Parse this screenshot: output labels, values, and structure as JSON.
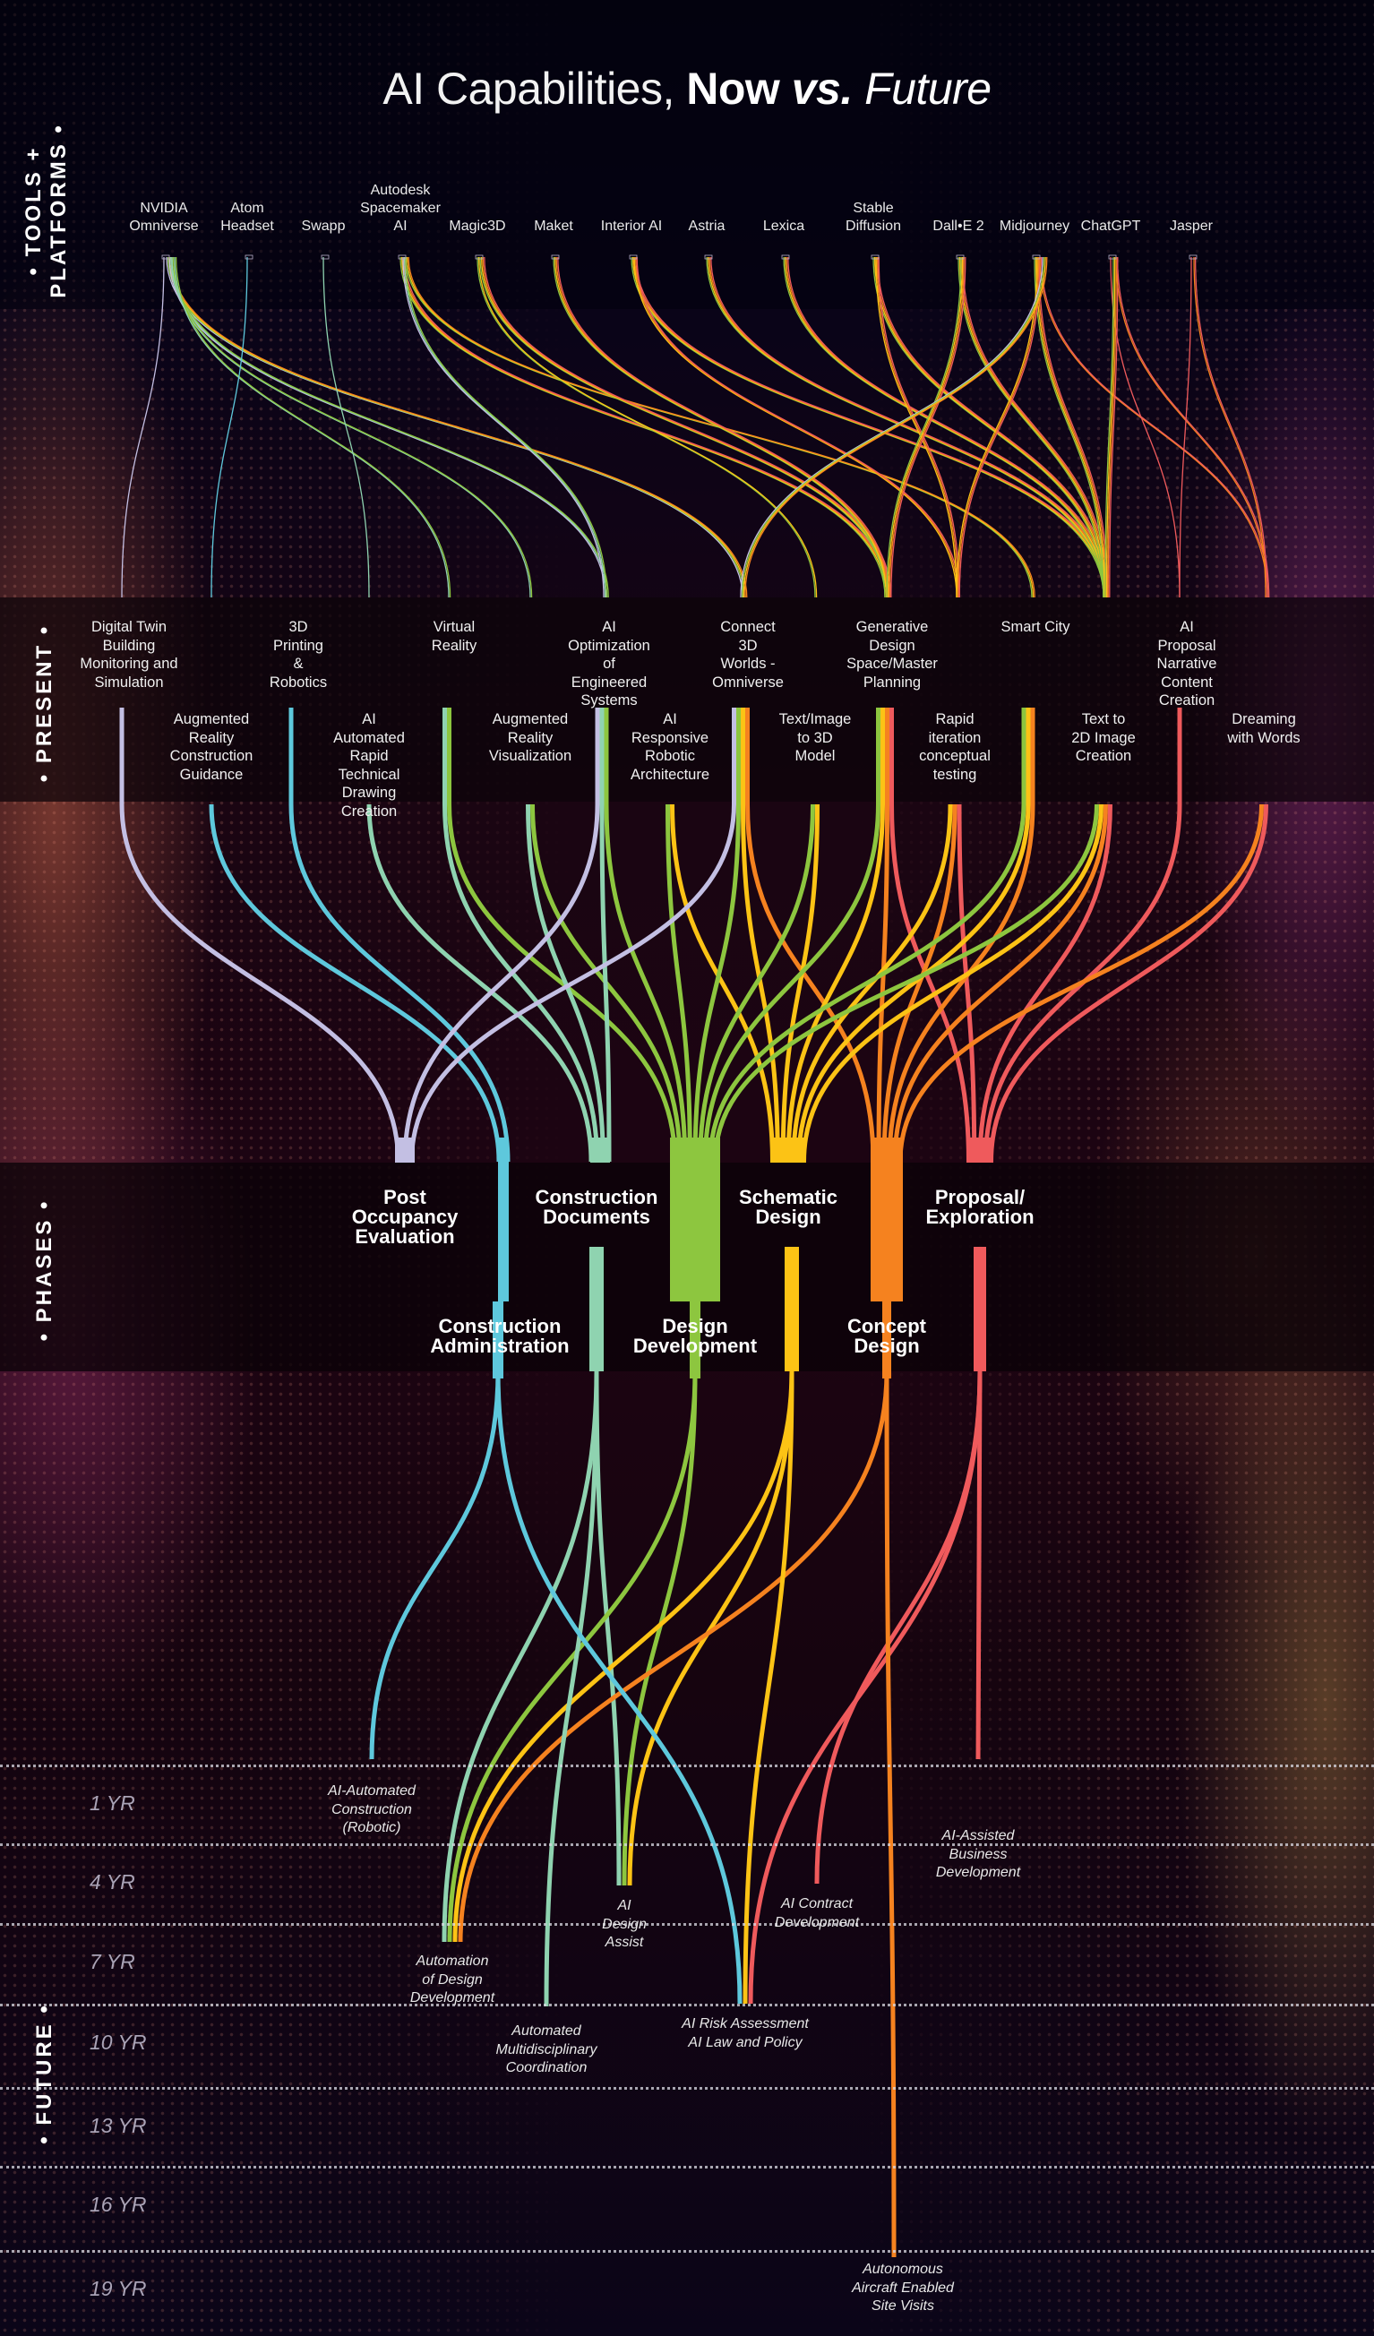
{
  "title": {
    "part1": "AI Capabilities, ",
    "part2": "Now",
    "part3": " vs.",
    "part4": " Future"
  },
  "sections": {
    "tools": "• TOOLS + PLATFORMS •",
    "tools_line1": "• TOOLS +",
    "tools_line2": "PLATFORMS •",
    "present": "• PRESENT •",
    "phases": "• PHASES •",
    "future": "• FUTURE •"
  },
  "colors": {
    "post_occupancy": "#c3bfe3",
    "construction_admin": "#5ec8dc",
    "construction_documents": "#8fd3b0",
    "design_development": "#8dc63f",
    "schematic_design": "#fcc315",
    "concept_design": "#f5821f",
    "proposal_exploration": "#ef5a5c"
  },
  "tools": [
    {
      "label": "NVIDIA\nOmniverse"
    },
    {
      "label": "Atom\nHeadset"
    },
    {
      "label": "Swapp"
    },
    {
      "label": "Autodesk\nSpacemaker\nAI"
    },
    {
      "label": "Magic3D"
    },
    {
      "label": "Maket"
    },
    {
      "label": "Interior AI"
    },
    {
      "label": "Astria"
    },
    {
      "label": "Lexica"
    },
    {
      "label": "Stable\nDiffusion"
    },
    {
      "label": "Dall•E 2"
    },
    {
      "label": "Midjourney"
    },
    {
      "label": "ChatGPT"
    },
    {
      "label": "Jasper"
    }
  ],
  "present": [
    {
      "label": "Digital Twin\nBuilding\nMonitoring and\nSimulation",
      "row": 1
    },
    {
      "label": "Augmented\nReality\nConstruction\nGuidance",
      "row": 2
    },
    {
      "label": "3D\nPrinting\n&\nRobotics",
      "row": 1
    },
    {
      "label": "AI\nAutomated\nRapid\nTechnical\nDrawing\nCreation",
      "row": 2
    },
    {
      "label": "Virtual\nReality",
      "row": 1
    },
    {
      "label": "Augmented\nReality\nVisualization",
      "row": 2
    },
    {
      "label": "AI\nOptimization\nof\nEngineered\nSystems",
      "row": 1
    },
    {
      "label": "AI\nResponsive\nRobotic\nArchitecture",
      "row": 2
    },
    {
      "label": "Connect\n3D\nWorlds -\nOmniverse",
      "row": 1
    },
    {
      "label": "Text/Image\nto 3D\nModel",
      "row": 2
    },
    {
      "label": "Generative\nDesign\nSpace/Master\nPlanning",
      "row": 1
    },
    {
      "label": "Rapid\niteration\nconceptual\ntesting",
      "row": 2
    },
    {
      "label": "Smart City",
      "row": 1
    },
    {
      "label": "Text to\n2D Image\nCreation",
      "row": 2
    },
    {
      "label": "AI\nProposal\nNarrative\nContent\nCreation",
      "row": 1
    },
    {
      "label": "Dreaming\nwith Words",
      "row": 2
    }
  ],
  "phases": [
    {
      "key": "post_occupancy",
      "label": "Post\nOccupancy\nEvaluation",
      "row": 1
    },
    {
      "key": "construction_admin",
      "label": "Construction\nAdministration",
      "row": 2
    },
    {
      "key": "construction_documents",
      "label": "Construction\nDocuments",
      "row": 1
    },
    {
      "key": "design_development",
      "label": "Design\nDevelopment",
      "row": 2
    },
    {
      "key": "schematic_design",
      "label": "Schematic\nDesign",
      "row": 1
    },
    {
      "key": "concept_design",
      "label": "Concept\nDesign",
      "row": 2
    },
    {
      "key": "proposal_exploration",
      "label": "Proposal/\nExploration",
      "row": 1
    }
  ],
  "timeline": [
    "1 YR",
    "4 YR",
    "7 YR",
    "10 YR",
    "13 YR",
    "16 YR",
    "19 YR"
  ],
  "future": [
    {
      "label": "AI-Automated\nConstruction\n(Robotic)",
      "years": 1,
      "phases": [
        "construction_admin"
      ]
    },
    {
      "label": "AI-Assisted\nBusiness\nDevelopment",
      "years": 1,
      "phases": [
        "proposal_exploration"
      ]
    },
    {
      "label": "AI\nDesign\nAssist",
      "years": 4,
      "phases": [
        "construction_documents",
        "design_development",
        "schematic_design"
      ]
    },
    {
      "label": "AI Contract\nDevelopment",
      "years": 4,
      "phases": [
        "proposal_exploration"
      ]
    },
    {
      "label": "Automation\nof Design\nDevelopment",
      "years": 7,
      "phases": [
        "construction_documents",
        "design_development",
        "schematic_design",
        "concept_design"
      ]
    },
    {
      "label": "Automated\nMultidisciplinary\nCoordination",
      "years": 10,
      "phases": [
        "construction_documents"
      ]
    },
    {
      "label": "AI Risk Assessment\nAI Law and Policy",
      "years": 10,
      "phases": [
        "construction_admin",
        "schematic_design",
        "proposal_exploration"
      ]
    },
    {
      "label": "Autonomous\nAircraft Enabled\nSite Visits",
      "years": 19,
      "phases": [
        "concept_design"
      ]
    }
  ],
  "present_to_phase": [
    [
      0,
      [
        "post_occupancy"
      ]
    ],
    [
      1,
      [
        "construction_admin"
      ]
    ],
    [
      2,
      [
        "construction_admin"
      ]
    ],
    [
      3,
      [
        "construction_documents"
      ]
    ],
    [
      4,
      [
        "construction_documents",
        "design_development"
      ]
    ],
    [
      5,
      [
        "construction_documents",
        "design_development"
      ]
    ],
    [
      6,
      [
        "post_occupancy",
        "construction_documents",
        "design_development"
      ]
    ],
    [
      7,
      [
        "design_development",
        "schematic_design"
      ]
    ],
    [
      8,
      [
        "post_occupancy",
        "design_development",
        "schematic_design",
        "concept_design"
      ]
    ],
    [
      9,
      [
        "design_development",
        "schematic_design"
      ]
    ],
    [
      10,
      [
        "design_development",
        "schematic_design",
        "concept_design",
        "proposal_exploration"
      ]
    ],
    [
      11,
      [
        "schematic_design",
        "concept_design",
        "proposal_exploration"
      ]
    ],
    [
      12,
      [
        "design_development",
        "schematic_design",
        "concept_design"
      ]
    ],
    [
      13,
      [
        "design_development",
        "schematic_design",
        "concept_design",
        "proposal_exploration"
      ]
    ],
    [
      14,
      [
        "proposal_exploration"
      ]
    ],
    [
      15,
      [
        "concept_design",
        "proposal_exploration"
      ]
    ]
  ],
  "tool_to_present": [
    [
      0,
      [
        0,
        8,
        6,
        5,
        4
      ]
    ],
    [
      1,
      [
        1
      ]
    ],
    [
      2,
      [
        3
      ]
    ],
    [
      3,
      [
        10,
        6,
        12
      ]
    ],
    [
      4,
      [
        9,
        10
      ]
    ],
    [
      5,
      [
        10
      ]
    ],
    [
      6,
      [
        13,
        11
      ]
    ],
    [
      7,
      [
        13
      ]
    ],
    [
      8,
      [
        13
      ]
    ],
    [
      9,
      [
        13,
        11
      ]
    ],
    [
      10,
      [
        13,
        10
      ]
    ],
    [
      11,
      [
        13,
        11,
        15,
        8
      ]
    ],
    [
      12,
      [
        14,
        13,
        15
      ]
    ],
    [
      13,
      [
        14,
        15
      ]
    ]
  ]
}
